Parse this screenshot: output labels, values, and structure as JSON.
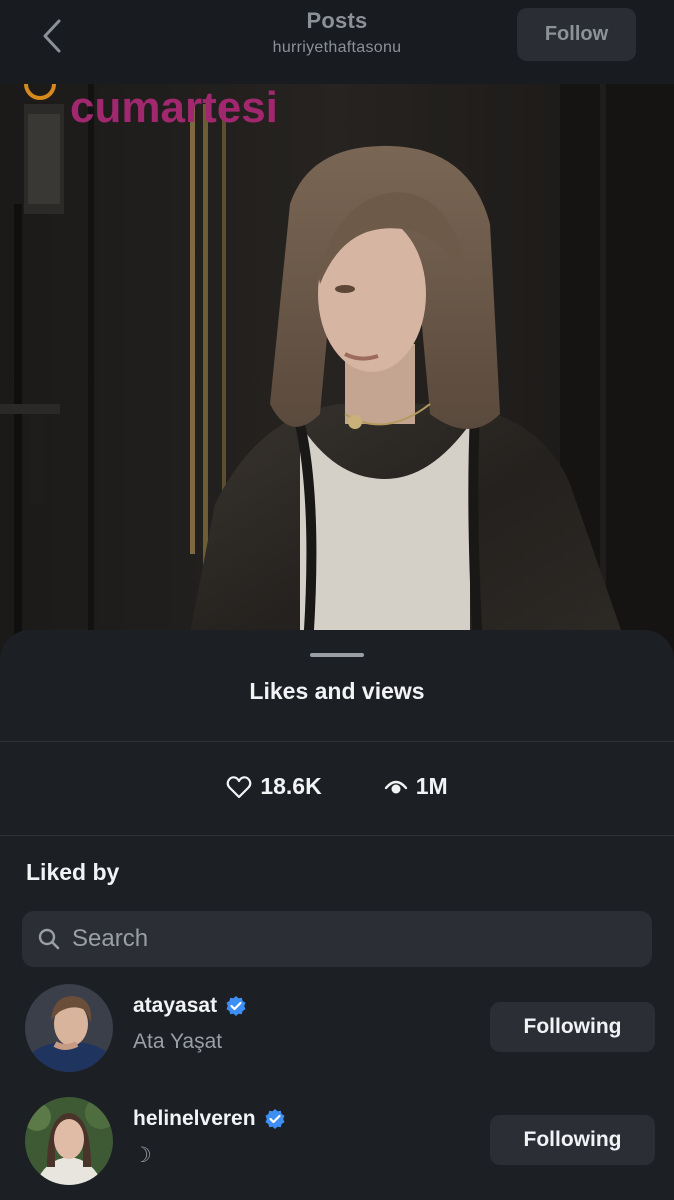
{
  "header": {
    "title": "Posts",
    "username": "hurriyethaftasonu",
    "follow_label": "Follow"
  },
  "post": {
    "watermark_text": "cumartesi"
  },
  "sheet": {
    "title": "Likes and views",
    "likes": "18.6K",
    "views": "1M",
    "liked_by_label": "Liked by",
    "search_placeholder": "Search"
  },
  "users": [
    {
      "username": "atayasat",
      "full_name": "Ata Yaşat",
      "verified": true,
      "button_label": "Following"
    },
    {
      "username": "helinelveren",
      "full_name": "☽",
      "verified": true,
      "button_label": "Following"
    }
  ],
  "colors": {
    "background": "#111418",
    "sheet": "#1c1f24",
    "button": "#2b2f35",
    "verified": "#3d8ff5",
    "muted_text": "#9a9ea5",
    "watermark": "#a1286e"
  }
}
